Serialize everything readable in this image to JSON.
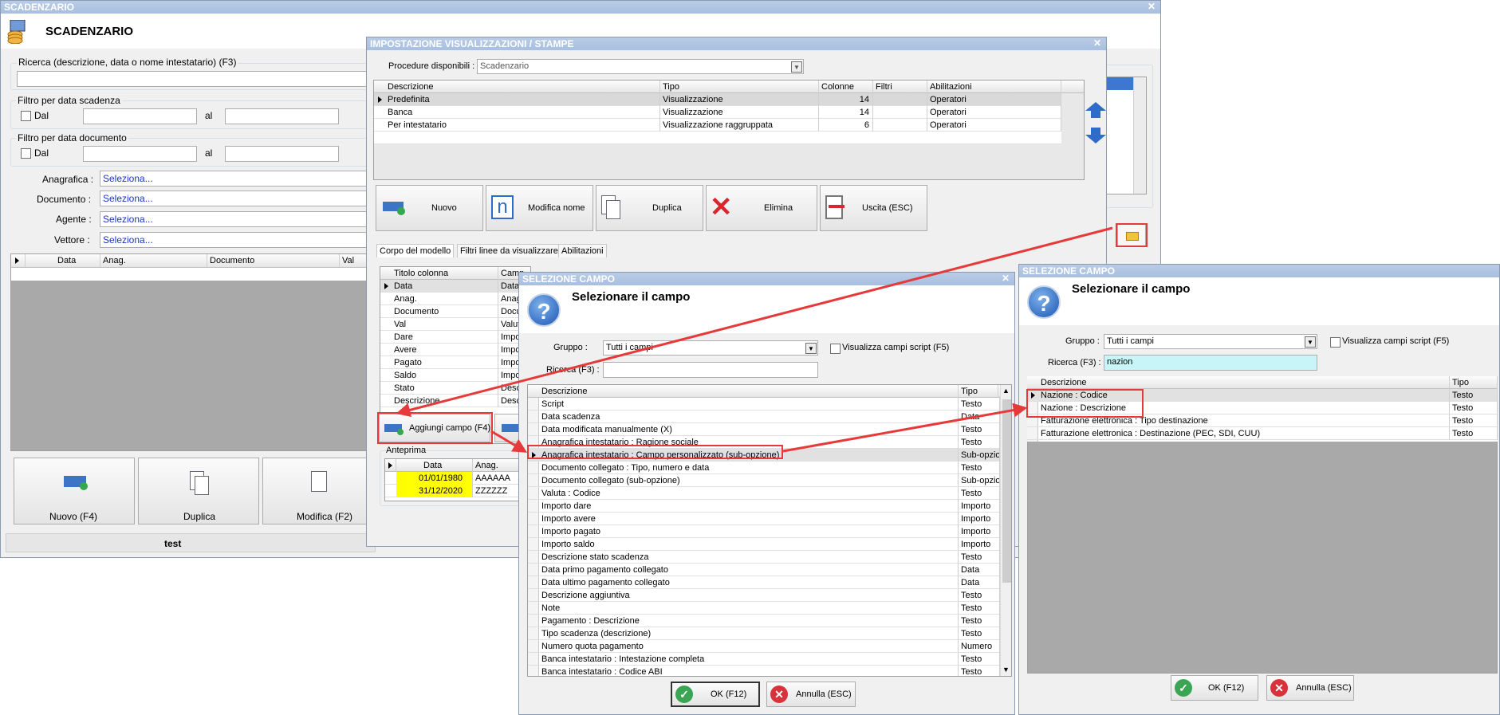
{
  "main": {
    "title_bar": "SCADENZARIO",
    "header": "SCADENZARIO",
    "search_label": "Ricerca (descrizione, data o nome intestatario) (F3)",
    "filter_due_date": {
      "title": "Filtro per data scadenza",
      "from": "Dal",
      "to": "al"
    },
    "filter_doc_date": {
      "title": "Filtro per data documento",
      "from": "Dal",
      "to": "al"
    },
    "fields": [
      {
        "label": "Anagrafica :",
        "value": "Seleziona..."
      },
      {
        "label": "Documento :",
        "value": "Seleziona..."
      },
      {
        "label": "Agente :",
        "value": "Seleziona..."
      },
      {
        "label": "Vettore :",
        "value": "Seleziona..."
      }
    ],
    "grid_cols": [
      "Data",
      "Anag.",
      "Documento",
      "Val"
    ],
    "buttons": [
      "Nuovo (F4)",
      "Duplica",
      "Modifica (F2)"
    ],
    "status": "test"
  },
  "impost": {
    "title": "IMPOSTAZIONE VISUALIZZAZIONI / STAMPE",
    "proc_label": "Procedure disponibili :",
    "proc_value": "Scadenzario",
    "cols": [
      "Descrizione",
      "Tipo",
      "Colonne",
      "Filtri",
      "Abilitazioni"
    ],
    "rows": [
      [
        "Predefinita",
        "Visualizzazione",
        "14",
        "",
        "Operatori"
      ],
      [
        "Banca",
        "Visualizzazione",
        "14",
        "",
        "Operatori"
      ],
      [
        "Per intestatario",
        "Visualizzazione raggruppata",
        "6",
        "",
        "Operatori"
      ]
    ],
    "buttons": [
      "Nuovo",
      "Modifica nome",
      "Duplica",
      "Elimina",
      "Uscita (ESC)"
    ],
    "tabs": [
      "Corpo del modello",
      "Filtri linee da visualizzare",
      "Abilitazioni"
    ],
    "body_cols": [
      "Titolo colonna",
      "Camp"
    ],
    "body_rows": [
      [
        "Data",
        "Data"
      ],
      [
        "Anag.",
        "Anag"
      ],
      [
        "Documento",
        "Docu"
      ],
      [
        "Val",
        "Valut"
      ],
      [
        "Dare",
        "Impo"
      ],
      [
        "Avere",
        "Impo"
      ],
      [
        "Pagato",
        "Impo"
      ],
      [
        "Saldo",
        "Impo"
      ],
      [
        "Stato",
        "Desc"
      ],
      [
        "Descrizione",
        "Desc"
      ]
    ],
    "add_field": "Aggiungi campo (F4)",
    "preview_label": "Anteprima",
    "preview_cols": [
      "Data",
      "Anag."
    ],
    "preview_rows": [
      [
        "01/01/1980",
        "AAAAAA"
      ],
      [
        "31/12/2020",
        "ZZZZZZ"
      ]
    ]
  },
  "sel1": {
    "title": "SELEZIONE CAMPO",
    "heading": "Selezionare il campo",
    "group_label": "Gruppo :",
    "group_value": "Tutti i campi",
    "script_label": "Visualizza campi script (F5)",
    "search_label": "Ricerca (F3) :",
    "search_value": "",
    "cols": [
      "Descrizione",
      "Tipo"
    ],
    "rows": [
      [
        "Script",
        "Testo"
      ],
      [
        "Data scadenza",
        "Data"
      ],
      [
        "Data modificata manualmente (X)",
        "Testo"
      ],
      [
        "Anagrafica intestatario : Ragione sociale",
        "Testo"
      ],
      [
        "Anagrafica intestatario : Campo personalizzato (sub-opzione)",
        "Sub-opzione"
      ],
      [
        "Documento collegato : Tipo, numero e data",
        "Testo"
      ],
      [
        "Documento collegato (sub-opzione)",
        "Sub-opzione"
      ],
      [
        "Valuta : Codice",
        "Testo"
      ],
      [
        "Importo dare",
        "Importo"
      ],
      [
        "Importo avere",
        "Importo"
      ],
      [
        "Importo pagato",
        "Importo"
      ],
      [
        "Importo saldo",
        "Importo"
      ],
      [
        "Descrizione stato scadenza",
        "Testo"
      ],
      [
        "Data primo pagamento collegato",
        "Data"
      ],
      [
        "Data ultimo pagamento collegato",
        "Data"
      ],
      [
        "Descrizione aggiuntiva",
        "Testo"
      ],
      [
        "Note",
        "Testo"
      ],
      [
        "Pagamento : Descrizione",
        "Testo"
      ],
      [
        "Tipo scadenza (descrizione)",
        "Testo"
      ],
      [
        "Numero quota pagamento",
        "Numero"
      ],
      [
        "Banca intestatario : Intestazione completa",
        "Testo"
      ],
      [
        "Banca intestatario : Codice ABI",
        "Testo"
      ]
    ],
    "ok": "OK (F12)",
    "cancel": "Annulla (ESC)"
  },
  "sel2": {
    "title": "SELEZIONE CAMPO",
    "heading": "Selezionare il campo",
    "group_label": "Gruppo :",
    "group_value": "Tutti i campi",
    "script_label": "Visualizza campi script (F5)",
    "search_label": "Ricerca (F3) :",
    "search_value": "nazion",
    "cols": [
      "Descrizione",
      "Tipo"
    ],
    "rows": [
      [
        "Nazione : Codice",
        "Testo"
      ],
      [
        "Nazione : Descrizione",
        "Testo"
      ],
      [
        "Fatturazione elettronica : Tipo destinazione",
        "Testo"
      ],
      [
        "Fatturazione elettronica : Destinazione (PEC, SDI, CUU)",
        "Testo"
      ]
    ],
    "ok": "OK (F12)",
    "cancel": "Annulla (ESC)"
  },
  "colors": {
    "accent_red": "#e63a3a",
    "preview_yellow": "#ffff00",
    "search_cyan": "#c8f5f8"
  }
}
